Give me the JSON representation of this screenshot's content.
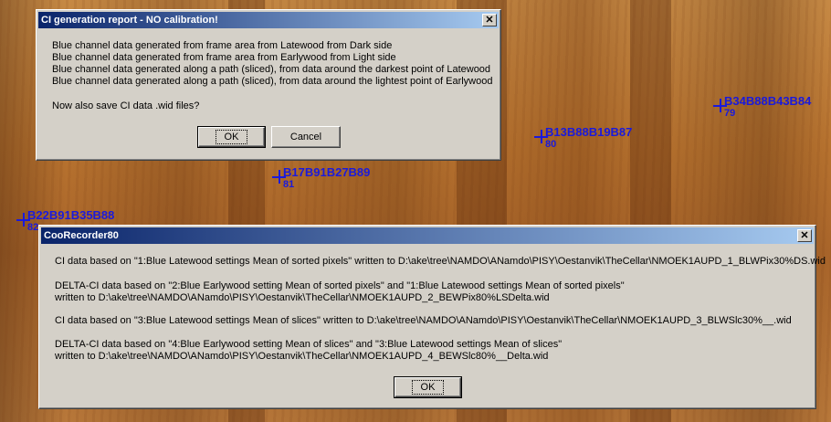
{
  "markers": [
    {
      "code": "B34B88B43B84",
      "num": "79"
    },
    {
      "code": "B13B88B19B87",
      "num": "80"
    },
    {
      "code": "B17B91B27B89",
      "num": "81"
    },
    {
      "code": "B22B91B35B88",
      "num": "82"
    }
  ],
  "dialog1": {
    "title": "CI generation report - NO calibration!",
    "close_glyph": "✕",
    "lines": [
      "Blue channel data generated from frame area from Latewood from Dark side",
      "Blue channel data generated from frame area from Earlywood from Light side",
      "Blue channel data generated along a path (sliced), from data around the darkest point of Latewood",
      "Blue channel data generated along a path (sliced), from data around the lightest point of Earlywood"
    ],
    "question": "Now also save CI data .wid files?",
    "ok_label": "OK",
    "cancel_label": "Cancel"
  },
  "dialog2": {
    "title": "CooRecorder80",
    "close_glyph": "✕",
    "lines": [
      "CI data based on \"1:Blue Latewood settings Mean of sorted pixels\" written to D:\\ake\\tree\\NAMDO\\ANamdo\\PISY\\Oestanvik\\TheCellar\\NMOEK1AUPD_1_BLWPix30%DS.wid",
      "DELTA-CI data based on \"2:Blue Earlywood setting Mean of sorted pixels\" and \"1:Blue Latewood settings Mean of sorted pixels\"",
      " written to D:\\ake\\tree\\NAMDO\\ANamdo\\PISY\\Oestanvik\\TheCellar\\NMOEK1AUPD_2_BEWPix80%LSDelta.wid",
      "CI data based on \"3:Blue Latewood settings Mean of slices\" written to D:\\ake\\tree\\NAMDO\\ANamdo\\PISY\\Oestanvik\\TheCellar\\NMOEK1AUPD_3_BLWSlc30%__.wid",
      "DELTA-CI data based on \"4:Blue Earlywood setting Mean of slices\" and \"3:Blue Latewood settings Mean of slices\"",
      " written to D:\\ake\\tree\\NAMDO\\ANamdo\\PISY\\Oestanvik\\TheCellar\\NMOEK1AUPD_4_BEWSlc80%__Delta.wid"
    ],
    "ok_label": "OK"
  }
}
